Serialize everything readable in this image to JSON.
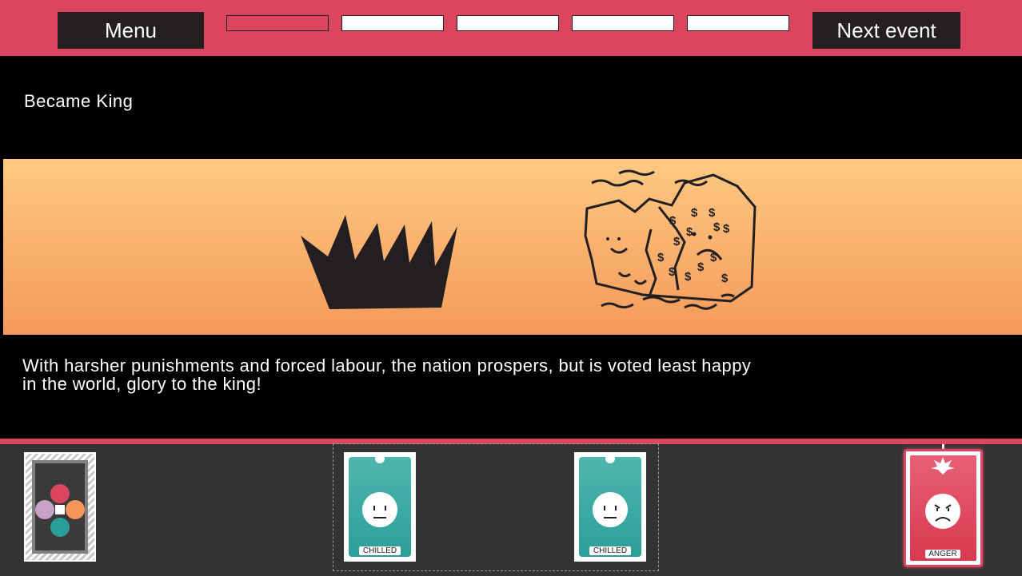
{
  "topbar": {
    "menu_label": "Menu",
    "next_label": "Next event",
    "progress": {
      "total": 5,
      "current": 1
    }
  },
  "event": {
    "title": "Became King",
    "description": "With harsher punishments and forced labour, the nation prospers, but is voted least happy in the world, glory to the king!",
    "illustrations": [
      "crown-icon",
      "money-faces-illustration"
    ]
  },
  "cards": {
    "deck": {
      "icon": "emotion-wheel-icon"
    },
    "played": [
      {
        "label": "CHILLED",
        "icon": "neutral-face-icon",
        "color": "#2c9e9a"
      },
      {
        "label": "CHILLED",
        "icon": "neutral-face-icon",
        "color": "#2c9e9a"
      }
    ],
    "hand": [
      {
        "label": "ANGER",
        "icon": "angry-face-icon",
        "color": "#dc4560"
      }
    ]
  },
  "colors": {
    "accent": "#dc4560",
    "bar_dark": "#231f20",
    "banner_top": "#fec982",
    "banner_bottom": "#f59a5b",
    "tray": "#333333"
  }
}
